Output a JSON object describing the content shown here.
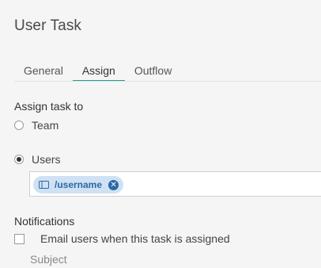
{
  "header": {
    "title": "User Task"
  },
  "tabs": [
    {
      "label": "General"
    },
    {
      "label": "Assign"
    },
    {
      "label": "Outflow"
    }
  ],
  "assign": {
    "label": "Assign task to",
    "options": [
      {
        "label": "Team",
        "selected": false
      },
      {
        "label": "Users",
        "selected": true
      }
    ],
    "users_field": {
      "chips": [
        {
          "label": "/username",
          "icon": "field-icon"
        }
      ]
    }
  },
  "notifications": {
    "label": "Notifications",
    "email_checkbox_label": "Email users when this task is assigned",
    "email_checked": false,
    "subject_label": "Subject"
  },
  "colors": {
    "accent": "#1f9e8f",
    "chip_bg": "#cfe1f3",
    "chip_text": "#2a6aa6"
  }
}
